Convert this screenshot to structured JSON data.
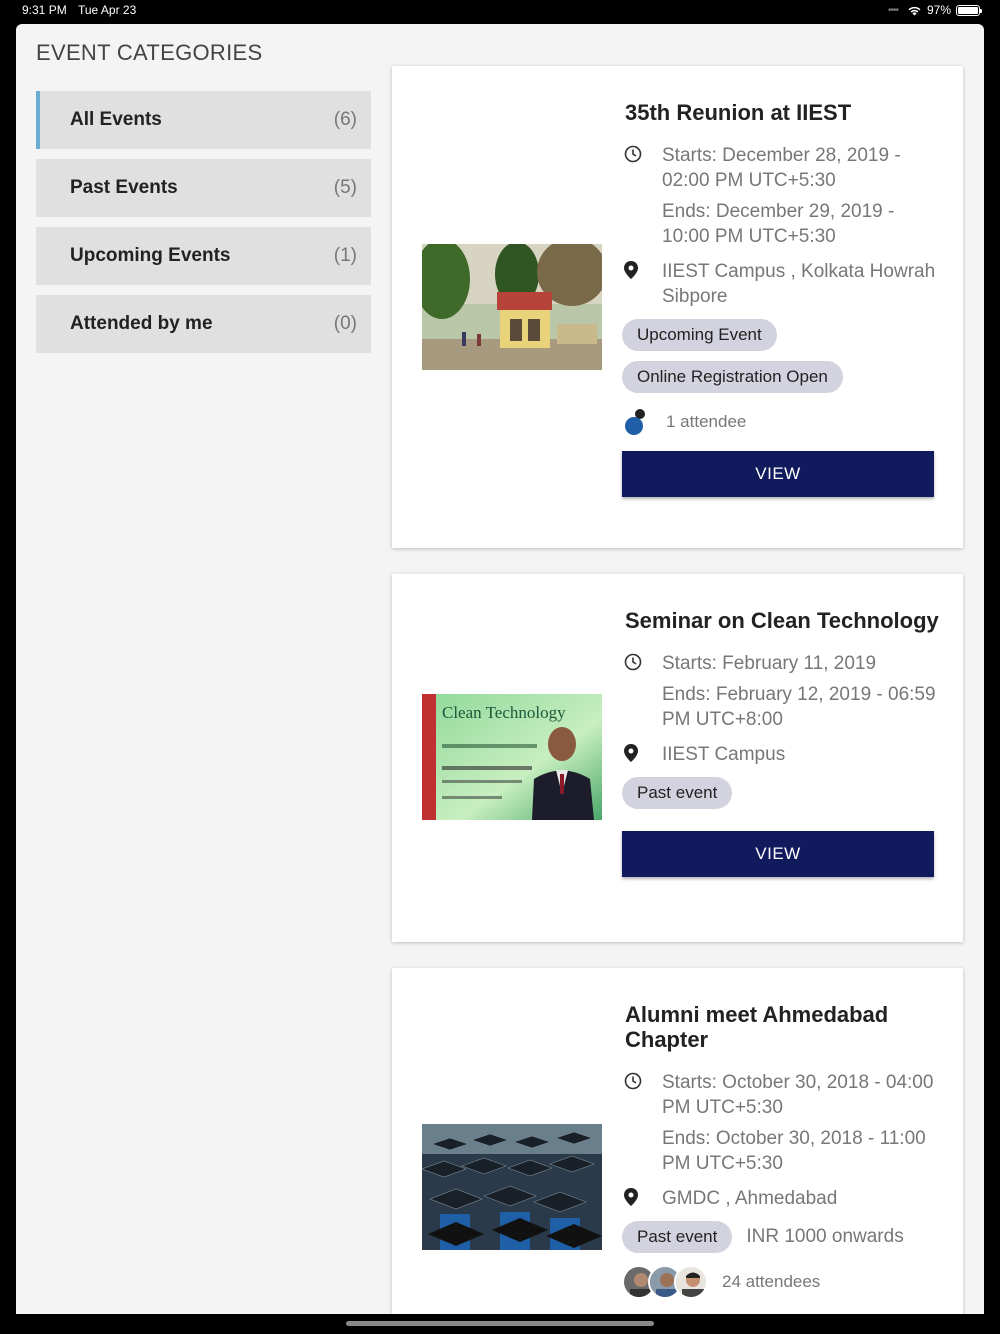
{
  "status_bar": {
    "time": "9:31 PM",
    "date": "Tue Apr 23",
    "battery": "97%"
  },
  "sidebar": {
    "title": "EVENT CATEGORIES",
    "categories": [
      {
        "label": "All Events",
        "count": "(6)",
        "active": true
      },
      {
        "label": "Past Events",
        "count": "(5)",
        "active": false
      },
      {
        "label": "Upcoming Events",
        "count": "(1)",
        "active": false
      },
      {
        "label": "Attended by me",
        "count": "(0)",
        "active": false
      }
    ]
  },
  "events": [
    {
      "title": "35th Reunion at IIEST",
      "starts": "Starts: December 28, 2019 - 02:00 PM UTC+5:30",
      "ends": "Ends: December 29, 2019 - 10:00 PM UTC+5:30",
      "location": "IIEST Campus , Kolkata Howrah Sibpore",
      "tags": [
        "Upcoming Event",
        "Online Registration Open"
      ],
      "attendees": "1 attendee",
      "view_label": "VIEW"
    },
    {
      "title": "Seminar on Clean Technology",
      "starts": "Starts: February 11, 2019",
      "ends": "Ends: February 12, 2019 - 06:59 PM UTC+8:00",
      "location": "IIEST Campus",
      "tags": [
        "Past event"
      ],
      "view_label": "VIEW",
      "image_text": "Clean Technology"
    },
    {
      "title": "Alumni meet Ahmedabad Chapter",
      "starts": "Starts: October 30, 2018 - 04:00 PM UTC+5:30",
      "ends": "Ends: October 30, 2018 - 11:00 PM UTC+5:30",
      "location": "GMDC , Ahmedabad",
      "tags": [
        "Past event"
      ],
      "price": "INR 1000 onwards",
      "attendees": "24 attendees"
    }
  ],
  "colors": {
    "accent": "#101a5c",
    "chip": "#d3d3df",
    "active_border": "#6aaed6"
  },
  "icons": {
    "time": "clock-icon",
    "location": "location-pin-icon"
  }
}
